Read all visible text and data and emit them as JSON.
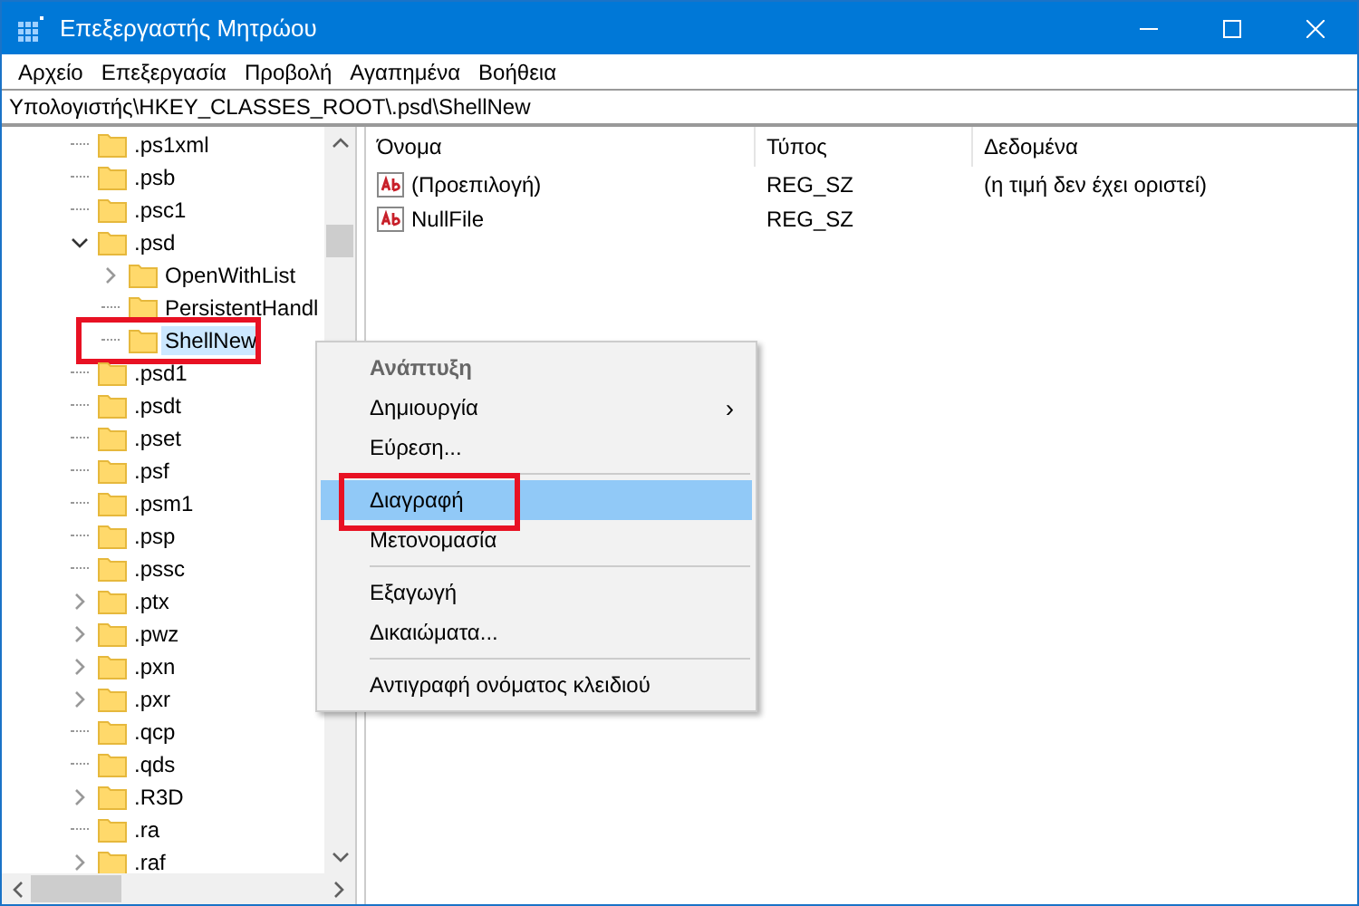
{
  "window": {
    "title": "Επεξεργαστής Μητρώου"
  },
  "menu": [
    "Αρχείο",
    "Επεξεργασία",
    "Προβολή",
    "Αγαπημένα",
    "Βοήθεια"
  ],
  "address": "Υπολογιστής\\HKEY_CLASSES_ROOT\\.psd\\ShellNew",
  "tree": [
    {
      "label": ".ps1xml",
      "kind": "leaf",
      "selected": false
    },
    {
      "label": ".psb",
      "kind": "leaf",
      "selected": false
    },
    {
      "label": ".psc1",
      "kind": "leaf",
      "selected": false
    },
    {
      "label": ".psd",
      "kind": "branch",
      "expanded": true,
      "selected": false,
      "children": [
        {
          "label": "OpenWithList",
          "kind": "branch",
          "expanded": false,
          "selected": false
        },
        {
          "label": "PersistentHandl",
          "kind": "leaf",
          "selected": false
        },
        {
          "label": "ShellNew",
          "kind": "leaf",
          "selected": true,
          "outlined": true
        }
      ]
    },
    {
      "label": ".psd1",
      "kind": "leaf",
      "selected": false
    },
    {
      "label": ".psdt",
      "kind": "leaf",
      "selected": false
    },
    {
      "label": ".pset",
      "kind": "leaf",
      "selected": false
    },
    {
      "label": ".psf",
      "kind": "leaf",
      "selected": false
    },
    {
      "label": ".psm1",
      "kind": "leaf",
      "selected": false
    },
    {
      "label": ".psp",
      "kind": "leaf",
      "selected": false
    },
    {
      "label": ".pssc",
      "kind": "leaf",
      "selected": false
    },
    {
      "label": ".ptx",
      "kind": "branch",
      "expanded": false,
      "selected": false
    },
    {
      "label": ".pwz",
      "kind": "branch",
      "expanded": false,
      "selected": false
    },
    {
      "label": ".pxn",
      "kind": "branch",
      "expanded": false,
      "selected": false
    },
    {
      "label": ".pxr",
      "kind": "branch",
      "expanded": false,
      "selected": false
    },
    {
      "label": ".qcp",
      "kind": "leaf",
      "selected": false
    },
    {
      "label": ".qds",
      "kind": "leaf",
      "selected": false
    },
    {
      "label": ".R3D",
      "kind": "branch",
      "expanded": false,
      "selected": false
    },
    {
      "label": ".ra",
      "kind": "leaf",
      "selected": false
    },
    {
      "label": ".raf",
      "kind": "branch",
      "expanded": false,
      "selected": false
    }
  ],
  "table": {
    "columns": [
      "Όνομα",
      "Τύπος",
      "Δεδομένα"
    ],
    "rows": [
      {
        "name": "(Προεπιλογή)",
        "type": "REG_SZ",
        "data": "(η τιμή δεν έχει οριστεί)"
      },
      {
        "name": "NullFile",
        "type": "REG_SZ",
        "data": ""
      }
    ]
  },
  "context_menu": [
    {
      "kind": "header",
      "label": "Ανάπτυξη"
    },
    {
      "kind": "submenu",
      "label": "Δημιουργία",
      "arrow": "›"
    },
    {
      "kind": "item",
      "label": "Εύρεση...",
      "highlighted": false,
      "outlined": false
    },
    {
      "kind": "separator"
    },
    {
      "kind": "item",
      "label": "Διαγραφή",
      "highlighted": true,
      "outlined": true
    },
    {
      "kind": "item",
      "label": "Μετονομασία",
      "highlighted": false,
      "outlined": false
    },
    {
      "kind": "separator"
    },
    {
      "kind": "item",
      "label": "Εξαγωγή",
      "highlighted": false,
      "outlined": false
    },
    {
      "kind": "item",
      "label": "Δικαιώματα...",
      "highlighted": false,
      "outlined": false
    },
    {
      "kind": "separator"
    },
    {
      "kind": "item",
      "label": "Αντιγραφή ονόματος κλειδιού",
      "highlighted": false,
      "outlined": false
    }
  ]
}
